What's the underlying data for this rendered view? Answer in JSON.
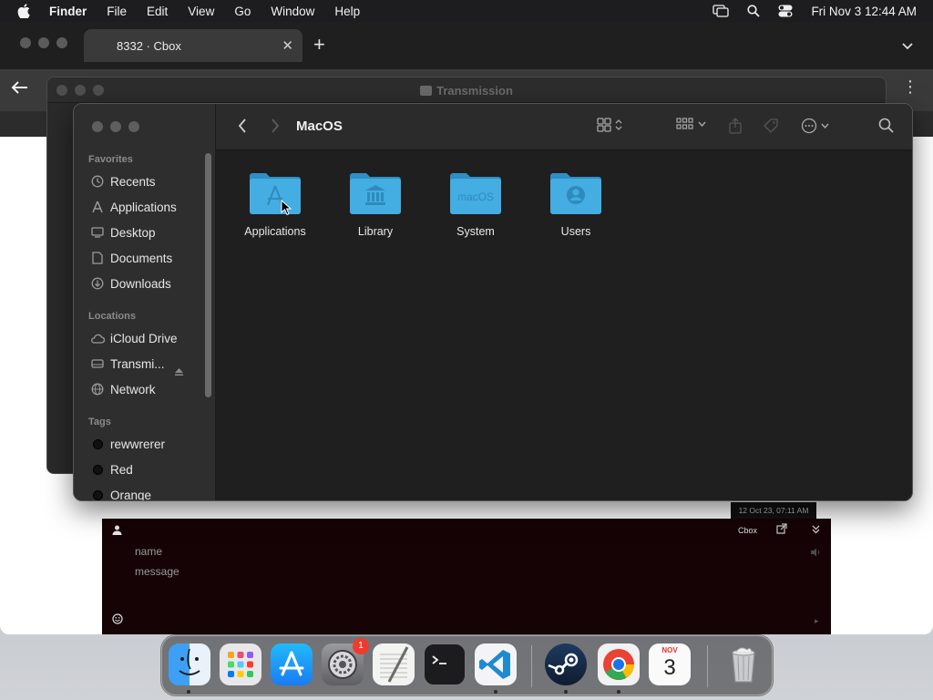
{
  "menubar": {
    "app_name": "Finder",
    "items": [
      "File",
      "Edit",
      "View",
      "Go",
      "Window",
      "Help"
    ],
    "clock": "Fri Nov 3  12:44 AM"
  },
  "browser": {
    "tab_title": "8332 · Cbox",
    "tab_close": "✕",
    "new_tab": "+"
  },
  "transmission": {
    "title": "Transmission"
  },
  "finder": {
    "title": "MacOS",
    "favorites_label": "Favorites",
    "favorites": [
      {
        "label": "Recents",
        "icon": "clock-icon"
      },
      {
        "label": "Applications",
        "icon": "applications-icon"
      },
      {
        "label": "Desktop",
        "icon": "desktop-icon"
      },
      {
        "label": "Documents",
        "icon": "document-icon"
      },
      {
        "label": "Downloads",
        "icon": "download-icon"
      }
    ],
    "locations_label": "Locations",
    "locations": [
      {
        "label": "iCloud Drive",
        "icon": "cloud-icon"
      },
      {
        "label": "Transmi...",
        "icon": "disk-icon"
      },
      {
        "label": "Network",
        "icon": "network-icon"
      }
    ],
    "tags_label": "Tags",
    "tags": [
      {
        "label": "rewwrerer"
      },
      {
        "label": "Red"
      },
      {
        "label": "Orange"
      }
    ],
    "folders": [
      {
        "label": "Applications",
        "icon": "applications-folder-icon"
      },
      {
        "label": "Library",
        "icon": "library-folder-icon"
      },
      {
        "label": "System",
        "icon": "system-folder-icon",
        "emblem": "macOS"
      },
      {
        "label": "Users",
        "icon": "users-folder-icon"
      }
    ]
  },
  "chat": {
    "timestamp": "12 Oct 23, 07:11 AM",
    "brand": "Cbox",
    "name_placeholder": "name",
    "message_placeholder": "message"
  },
  "dock": {
    "apps": [
      "Finder",
      "Launchpad",
      "App Store",
      "System Settings",
      "TextEdit",
      "Terminal",
      "Visual Studio Code",
      "Steam",
      "Google Chrome",
      "Calendar",
      "Trash"
    ],
    "settings_badge": "1",
    "calendar_month": "NOV",
    "calendar_day": "3"
  },
  "colors": {
    "folder_blue": "#3ea8dc",
    "badge_red": "#f03a2e",
    "chat_bg": "#160306"
  }
}
